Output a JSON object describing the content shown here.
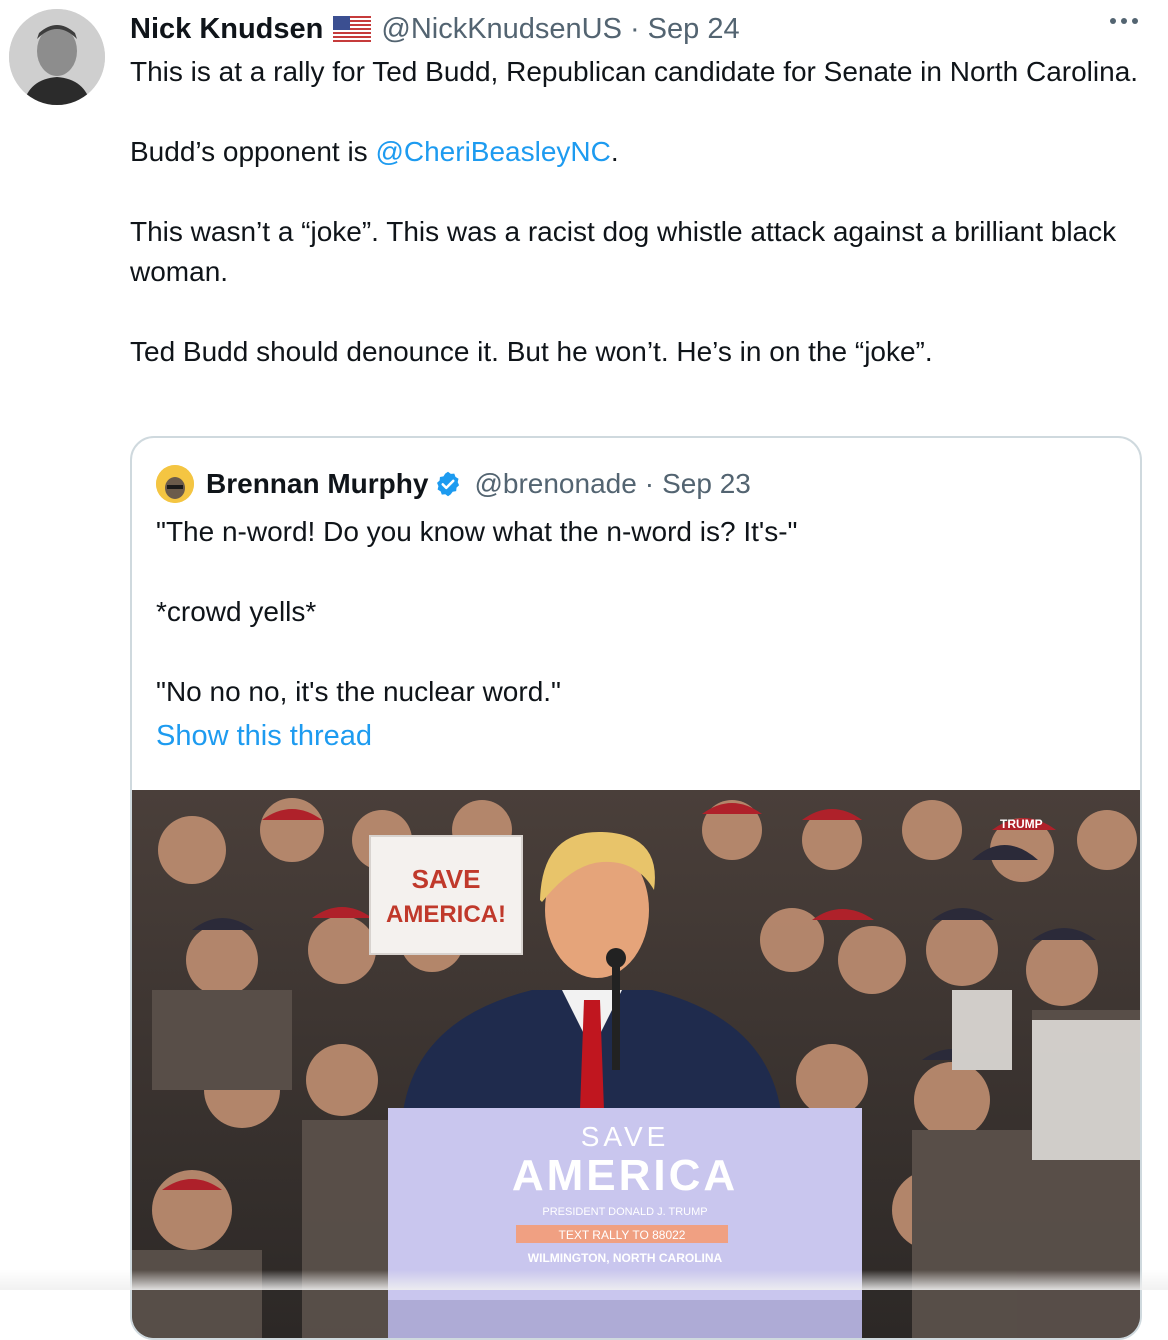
{
  "tweet": {
    "author_name": "Nick Knudsen",
    "author_handle": "@NickKnudsenUS",
    "separator": "·",
    "date": "Sep 24",
    "text_1": "This is at a rally for Ted Budd, Republican candidate for Senate in North Carolina.\n\nBudd’s opponent is ",
    "mention": "@CheriBeasleyNC",
    "text_2": ".\n\nThis wasn’t a “joke”. This was a racist dog whistle attack against a brilliant black woman.\n\nTed Budd should denounce it. But he won’t. He’s in on the “joke”.",
    "flag_icon": "us-flag-icon",
    "more_icon": "more-options-icon"
  },
  "quoted_tweet": {
    "author_name": "Brennan Murphy",
    "author_handle": "@brenonade",
    "separator": "·",
    "date": "Sep 23",
    "text": "\"The n-word! Do you know what the n-word is? It's-\"\n\n*crowd yells*\n\n\"No no no, it's the nuclear word.\"",
    "show_thread": "Show this thread",
    "verified_icon": "verified-badge-icon"
  },
  "media": {
    "sign_line1": "SAVE",
    "sign_line2": "AMERICA!",
    "podium_line1": "SAVE",
    "podium_line2": "AMERICA",
    "podium_line3": "PRESIDENT DONALD J. TRUMP",
    "podium_line4": "TEXT RALLY TO 88022",
    "podium_line5": "WILMINGTON, NORTH CAROLINA",
    "hat_text": "TRUMP",
    "colors": {
      "podium": "#c9c6ee",
      "crowd_red": "#b5202a",
      "crowd_dark": "#3a3430",
      "link_blue": "#1d9bf0"
    }
  }
}
